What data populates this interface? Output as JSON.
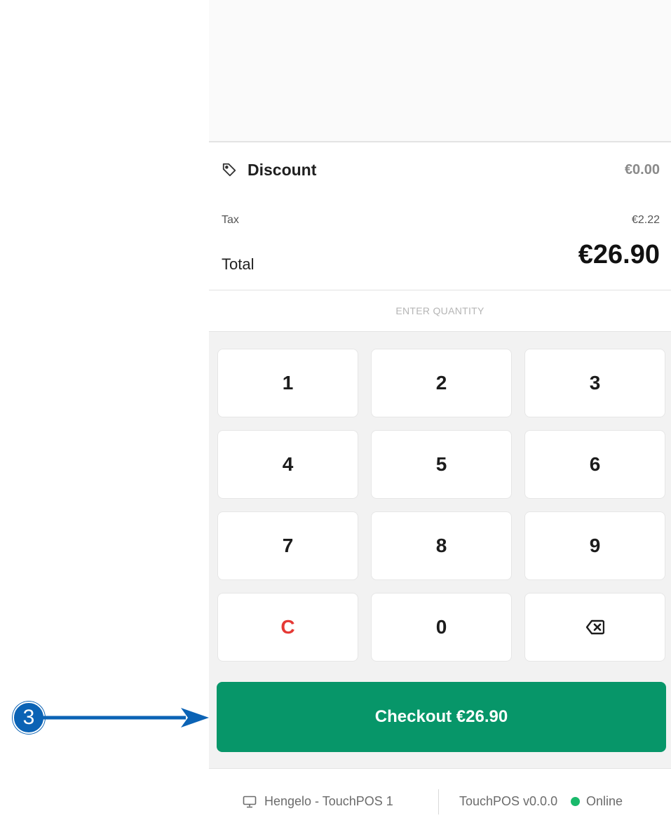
{
  "summary": {
    "discount_label": "Discount",
    "discount_value": "€0.00",
    "tax_label": "Tax",
    "tax_value": "€2.22",
    "total_label": "Total",
    "total_value": "€26.90"
  },
  "quantity": {
    "header": "ENTER QUANTITY"
  },
  "keypad": {
    "keys": [
      "1",
      "2",
      "3",
      "4",
      "5",
      "6",
      "7",
      "8",
      "9",
      "C",
      "0"
    ],
    "backspace_icon": "backspace-icon"
  },
  "checkout": {
    "label": "Checkout €26.90"
  },
  "footer": {
    "device": "Hengelo - TouchPOS 1",
    "version": "TouchPOS v0.0.0",
    "status": "Online",
    "status_color": "#19b96b"
  },
  "annotation": {
    "badge": "3"
  },
  "colors": {
    "checkout_bg": "#079669",
    "clear_key": "#e53935",
    "callout": "#0b63b5"
  }
}
